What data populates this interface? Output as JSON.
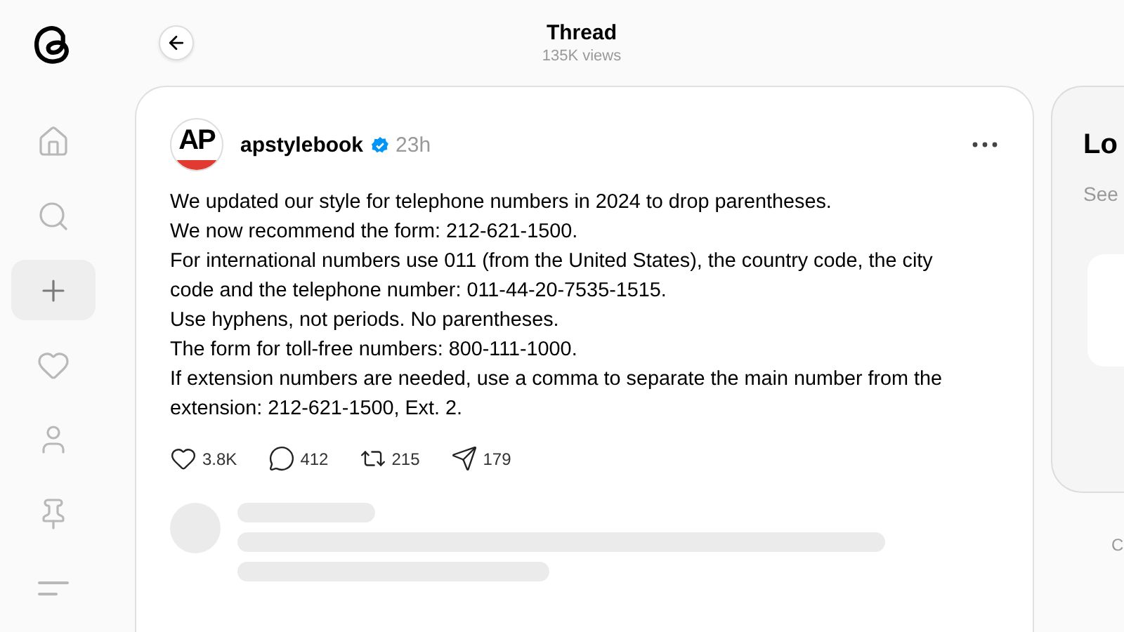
{
  "sidebar": {
    "items": [
      {
        "kind": "home",
        "selected": false
      },
      {
        "kind": "search",
        "selected": false
      },
      {
        "kind": "create",
        "selected": true
      },
      {
        "kind": "activity",
        "selected": false
      },
      {
        "kind": "profile",
        "selected": false
      },
      {
        "kind": "pinned",
        "selected": false
      },
      {
        "kind": "menu",
        "selected": false
      }
    ]
  },
  "header": {
    "title": "Thread",
    "subtitle": "135K views"
  },
  "post": {
    "avatar_text": "AP",
    "author": "apstylebook",
    "verified": true,
    "time": "23h",
    "lines": [
      "We updated our style for telephone numbers in 2024 to drop parentheses.",
      "We now recommend the form: 212-621-1500.",
      "For international numbers use 011 (from the United States), the country code, the city code and the telephone number: 011-44-20-7535-1515.",
      "Use hyphens, not periods. No parentheses.",
      "The form for toll-free numbers: 800-111-1000.",
      "If extension numbers are needed, use a comma to separate the main number from the extension: 212-621-1500, Ext. 2."
    ],
    "actions": [
      {
        "kind": "like",
        "count": "3.8K"
      },
      {
        "kind": "reply",
        "count": "412"
      },
      {
        "kind": "repost",
        "count": "215"
      },
      {
        "kind": "share",
        "count": "179"
      }
    ]
  },
  "side_card": {
    "title": "Lo",
    "text": "See"
  },
  "footer_text": "C"
}
